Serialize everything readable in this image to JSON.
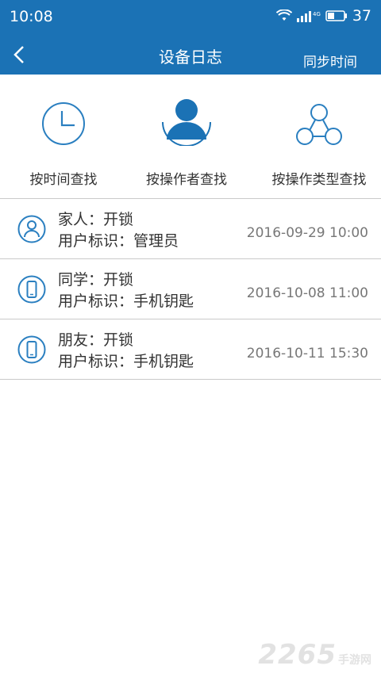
{
  "status": {
    "time": "10:08",
    "battery": "37",
    "network": "4G"
  },
  "header": {
    "title": "设备日志",
    "sync_label": "同步时间"
  },
  "filters": [
    {
      "label": "按时间查找",
      "icon": "clock-icon"
    },
    {
      "label": "按操作者查找",
      "icon": "person-icon"
    },
    {
      "label": "按操作类型查找",
      "icon": "share-icon"
    }
  ],
  "logs": [
    {
      "who": "家人：开锁",
      "id": "用户标识：管理员",
      "time": "2016-09-29  10:00",
      "icon": "user-circle-icon"
    },
    {
      "who": "同学：开锁",
      "id": "用户标识：手机钥匙",
      "time": "2016-10-08  11:00",
      "icon": "phone-circle-icon"
    },
    {
      "who": "朋友：开锁",
      "id": "用户标识：手机钥匙",
      "time": "2016-10-11  15:30",
      "icon": "phone-circle-icon"
    }
  ],
  "watermark": {
    "number": "2265",
    "text": "手游网"
  },
  "colors": {
    "primary": "#1b72b5",
    "icon": "#2a7fc0"
  }
}
